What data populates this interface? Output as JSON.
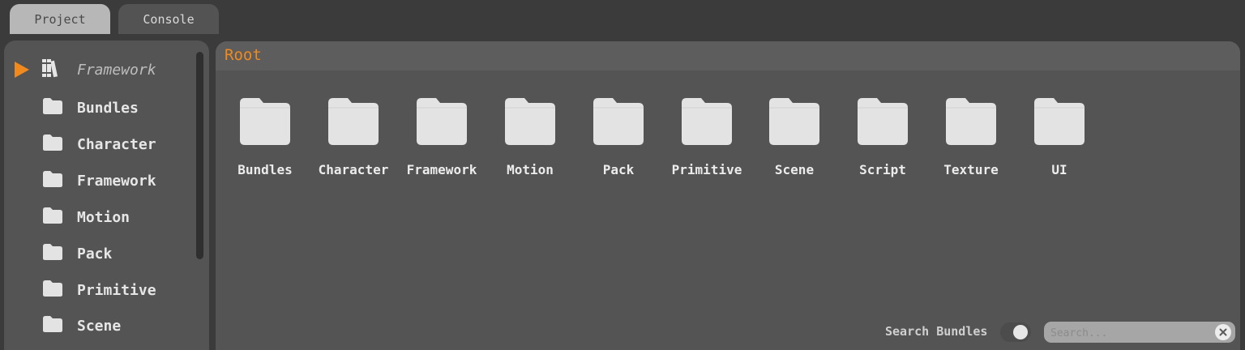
{
  "tabs": [
    {
      "label": "Project",
      "active": true
    },
    {
      "label": "Console",
      "active": false
    }
  ],
  "sidebar": {
    "items": [
      {
        "label": "Framework",
        "icon": "books-icon",
        "expanded_arrow": true
      },
      {
        "label": "Bundles",
        "icon": "folder-icon"
      },
      {
        "label": "Character",
        "icon": "folder-icon"
      },
      {
        "label": "Framework",
        "icon": "folder-icon"
      },
      {
        "label": "Motion",
        "icon": "folder-icon"
      },
      {
        "label": "Pack",
        "icon": "folder-icon"
      },
      {
        "label": "Primitive",
        "icon": "folder-icon"
      },
      {
        "label": "Scene",
        "icon": "folder-icon"
      }
    ]
  },
  "breadcrumb": {
    "label": "Root"
  },
  "folders": [
    {
      "label": "Bundles"
    },
    {
      "label": "Character"
    },
    {
      "label": "Framework"
    },
    {
      "label": "Motion"
    },
    {
      "label": "Pack"
    },
    {
      "label": "Primitive"
    },
    {
      "label": "Scene"
    },
    {
      "label": "Script"
    },
    {
      "label": "Texture"
    },
    {
      "label": "UI"
    }
  ],
  "search": {
    "label": "Search Bundles",
    "toggle_on": true,
    "placeholder": "Search...",
    "value": ""
  },
  "colors": {
    "accent": "#f08a1e",
    "panel": "#545454",
    "background": "#3b3b3b",
    "folder": "#e3e3e3"
  }
}
